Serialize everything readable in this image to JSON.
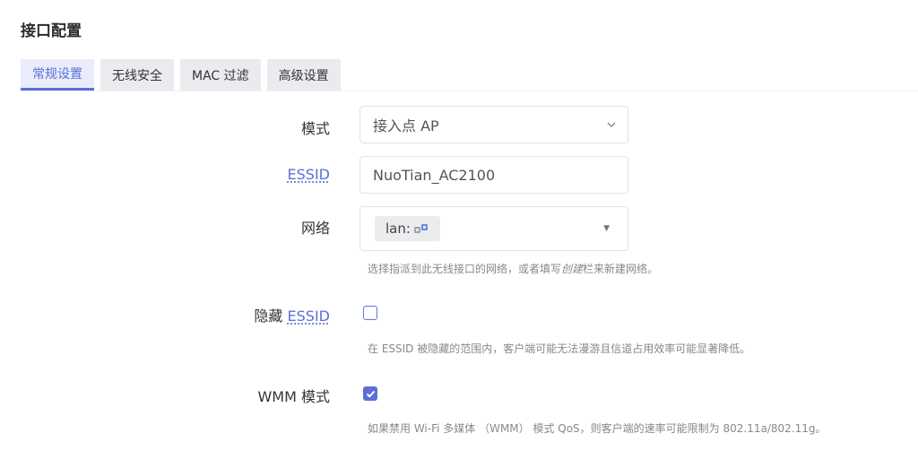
{
  "section": {
    "title": "接口配置"
  },
  "tabs": [
    {
      "label": "常规设置",
      "active": true
    },
    {
      "label": "无线安全",
      "active": false
    },
    {
      "label": "MAC 过滤",
      "active": false
    },
    {
      "label": "高级设置",
      "active": false
    }
  ],
  "form": {
    "mode": {
      "label": "模式",
      "value": "接入点 AP"
    },
    "essid": {
      "label": "ESSID",
      "value": "NuoTian_AC2100"
    },
    "network": {
      "label": "网络",
      "chip": "lan:",
      "chip_icon": "network-ports-icon",
      "help_prefix": "选择指派到此无线接口的网络，或者填写",
      "help_em": "创建",
      "help_suffix": "栏来新建网络。"
    },
    "hide_essid": {
      "label_prefix": "隐藏",
      "label_link": "ESSID",
      "checked": false,
      "help": "在 ESSID 被隐藏的范围内，客户端可能无法漫游且信道占用效率可能显著降低。"
    },
    "wmm": {
      "label": "WMM 模式",
      "checked": true,
      "help": "如果禁用 Wi-Fi 多媒体 （WMM） 模式 QoS，则客户端的速率可能限制为 802.11a/802.11g。"
    }
  },
  "colors": {
    "accent": "#5b6fd8",
    "tab_bg": "#e9ebef",
    "help_text": "#888888"
  }
}
